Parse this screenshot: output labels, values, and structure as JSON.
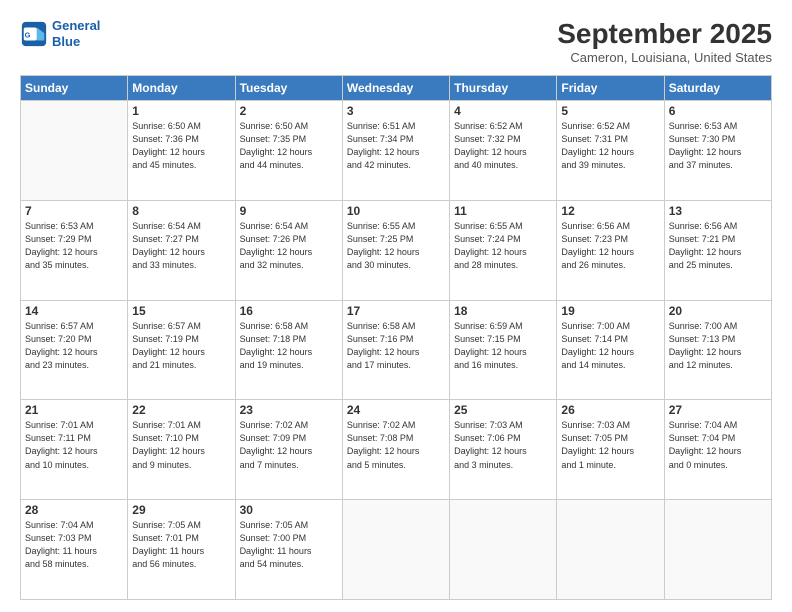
{
  "header": {
    "logo_line1": "General",
    "logo_line2": "Blue",
    "title": "September 2025",
    "subtitle": "Cameron, Louisiana, United States"
  },
  "columns": [
    "Sunday",
    "Monday",
    "Tuesday",
    "Wednesday",
    "Thursday",
    "Friday",
    "Saturday"
  ],
  "weeks": [
    [
      {
        "day": "",
        "info": ""
      },
      {
        "day": "1",
        "info": "Sunrise: 6:50 AM\nSunset: 7:36 PM\nDaylight: 12 hours\nand 45 minutes."
      },
      {
        "day": "2",
        "info": "Sunrise: 6:50 AM\nSunset: 7:35 PM\nDaylight: 12 hours\nand 44 minutes."
      },
      {
        "day": "3",
        "info": "Sunrise: 6:51 AM\nSunset: 7:34 PM\nDaylight: 12 hours\nand 42 minutes."
      },
      {
        "day": "4",
        "info": "Sunrise: 6:52 AM\nSunset: 7:32 PM\nDaylight: 12 hours\nand 40 minutes."
      },
      {
        "day": "5",
        "info": "Sunrise: 6:52 AM\nSunset: 7:31 PM\nDaylight: 12 hours\nand 39 minutes."
      },
      {
        "day": "6",
        "info": "Sunrise: 6:53 AM\nSunset: 7:30 PM\nDaylight: 12 hours\nand 37 minutes."
      }
    ],
    [
      {
        "day": "7",
        "info": "Sunrise: 6:53 AM\nSunset: 7:29 PM\nDaylight: 12 hours\nand 35 minutes."
      },
      {
        "day": "8",
        "info": "Sunrise: 6:54 AM\nSunset: 7:27 PM\nDaylight: 12 hours\nand 33 minutes."
      },
      {
        "day": "9",
        "info": "Sunrise: 6:54 AM\nSunset: 7:26 PM\nDaylight: 12 hours\nand 32 minutes."
      },
      {
        "day": "10",
        "info": "Sunrise: 6:55 AM\nSunset: 7:25 PM\nDaylight: 12 hours\nand 30 minutes."
      },
      {
        "day": "11",
        "info": "Sunrise: 6:55 AM\nSunset: 7:24 PM\nDaylight: 12 hours\nand 28 minutes."
      },
      {
        "day": "12",
        "info": "Sunrise: 6:56 AM\nSunset: 7:23 PM\nDaylight: 12 hours\nand 26 minutes."
      },
      {
        "day": "13",
        "info": "Sunrise: 6:56 AM\nSunset: 7:21 PM\nDaylight: 12 hours\nand 25 minutes."
      }
    ],
    [
      {
        "day": "14",
        "info": "Sunrise: 6:57 AM\nSunset: 7:20 PM\nDaylight: 12 hours\nand 23 minutes."
      },
      {
        "day": "15",
        "info": "Sunrise: 6:57 AM\nSunset: 7:19 PM\nDaylight: 12 hours\nand 21 minutes."
      },
      {
        "day": "16",
        "info": "Sunrise: 6:58 AM\nSunset: 7:18 PM\nDaylight: 12 hours\nand 19 minutes."
      },
      {
        "day": "17",
        "info": "Sunrise: 6:58 AM\nSunset: 7:16 PM\nDaylight: 12 hours\nand 17 minutes."
      },
      {
        "day": "18",
        "info": "Sunrise: 6:59 AM\nSunset: 7:15 PM\nDaylight: 12 hours\nand 16 minutes."
      },
      {
        "day": "19",
        "info": "Sunrise: 7:00 AM\nSunset: 7:14 PM\nDaylight: 12 hours\nand 14 minutes."
      },
      {
        "day": "20",
        "info": "Sunrise: 7:00 AM\nSunset: 7:13 PM\nDaylight: 12 hours\nand 12 minutes."
      }
    ],
    [
      {
        "day": "21",
        "info": "Sunrise: 7:01 AM\nSunset: 7:11 PM\nDaylight: 12 hours\nand 10 minutes."
      },
      {
        "day": "22",
        "info": "Sunrise: 7:01 AM\nSunset: 7:10 PM\nDaylight: 12 hours\nand 9 minutes."
      },
      {
        "day": "23",
        "info": "Sunrise: 7:02 AM\nSunset: 7:09 PM\nDaylight: 12 hours\nand 7 minutes."
      },
      {
        "day": "24",
        "info": "Sunrise: 7:02 AM\nSunset: 7:08 PM\nDaylight: 12 hours\nand 5 minutes."
      },
      {
        "day": "25",
        "info": "Sunrise: 7:03 AM\nSunset: 7:06 PM\nDaylight: 12 hours\nand 3 minutes."
      },
      {
        "day": "26",
        "info": "Sunrise: 7:03 AM\nSunset: 7:05 PM\nDaylight: 12 hours\nand 1 minute."
      },
      {
        "day": "27",
        "info": "Sunrise: 7:04 AM\nSunset: 7:04 PM\nDaylight: 12 hours\nand 0 minutes."
      }
    ],
    [
      {
        "day": "28",
        "info": "Sunrise: 7:04 AM\nSunset: 7:03 PM\nDaylight: 11 hours\nand 58 minutes."
      },
      {
        "day": "29",
        "info": "Sunrise: 7:05 AM\nSunset: 7:01 PM\nDaylight: 11 hours\nand 56 minutes."
      },
      {
        "day": "30",
        "info": "Sunrise: 7:05 AM\nSunset: 7:00 PM\nDaylight: 11 hours\nand 54 minutes."
      },
      {
        "day": "",
        "info": ""
      },
      {
        "day": "",
        "info": ""
      },
      {
        "day": "",
        "info": ""
      },
      {
        "day": "",
        "info": ""
      }
    ]
  ]
}
